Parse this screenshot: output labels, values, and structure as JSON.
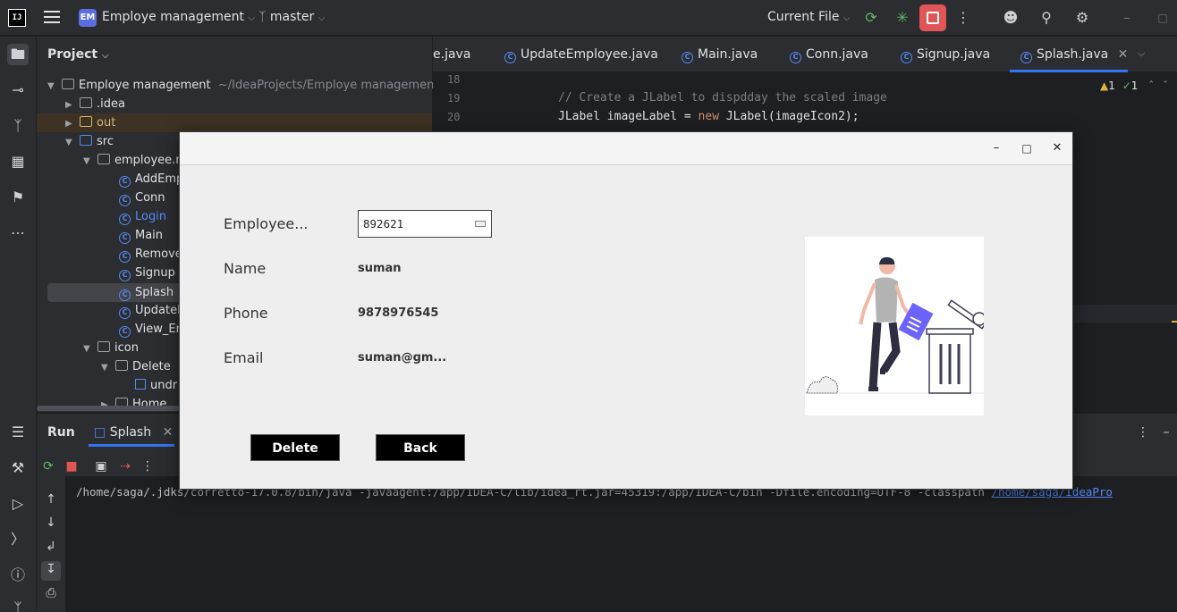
{
  "titlebar": {
    "logo": "IJ",
    "project_badge": "EM",
    "project_name": "Employe management",
    "branch": "master",
    "run_config": "Current File"
  },
  "project_panel": {
    "title": "Project",
    "root": {
      "name": "Employe management",
      "path": "~/IdeaProjects/Employe management"
    },
    "items": [
      {
        "label": ".idea"
      },
      {
        "label": "out"
      },
      {
        "label": "src"
      },
      {
        "label": "employee.m"
      },
      {
        "label": "AddEmp"
      },
      {
        "label": "Conn"
      },
      {
        "label": "Login"
      },
      {
        "label": "Main"
      },
      {
        "label": "Remove"
      },
      {
        "label": "Signup"
      },
      {
        "label": "Splash"
      },
      {
        "label": "UpdateE"
      },
      {
        "label": "View_Er"
      },
      {
        "label": "icon"
      },
      {
        "label": "Delete"
      },
      {
        "label": "undr"
      },
      {
        "label": "Home"
      }
    ]
  },
  "editor": {
    "tabs": [
      "e.java",
      "UpdateEmployee.java",
      "Main.java",
      "Conn.java",
      "Signup.java",
      "Splash.java"
    ],
    "active_tab": "Splash.java",
    "line_numbers": [
      "18",
      "19",
      "20"
    ],
    "code_comment": "// Create a JLabel to dispdday the scaled image",
    "code_line_kw1": "JLabel imageLabel = ",
    "code_line_new": "new",
    "code_line_rest": " JLabel(imageIcon2);",
    "inspections_warn": "1",
    "inspections_ok": "1"
  },
  "run_panel": {
    "title": "Run",
    "tab": "Splash",
    "console_text": "/home/saga/.jdks/corretto-17.0.8/bin/java -javaagent:/app/IDEA-C/lib/idea_rt.jar=45319:/app/IDEA-C/bin -Dfile.encoding=UTF-8 -classpath ",
    "console_link": "/home/saga/IdeaPro"
  },
  "dialog": {
    "fields": {
      "employee_label": "Employee...",
      "employee_value": "892621",
      "name_label": "Name",
      "name_value": "suman",
      "phone_label": "Phone",
      "phone_value": "9878976545",
      "email_label": "Email",
      "email_value": "suman@gm..."
    },
    "delete_button": "Delete",
    "back_button": "Back"
  },
  "colors": {
    "accent": "#3574f0",
    "stop": "#e05555",
    "illustration_accent": "#6c63ff"
  }
}
